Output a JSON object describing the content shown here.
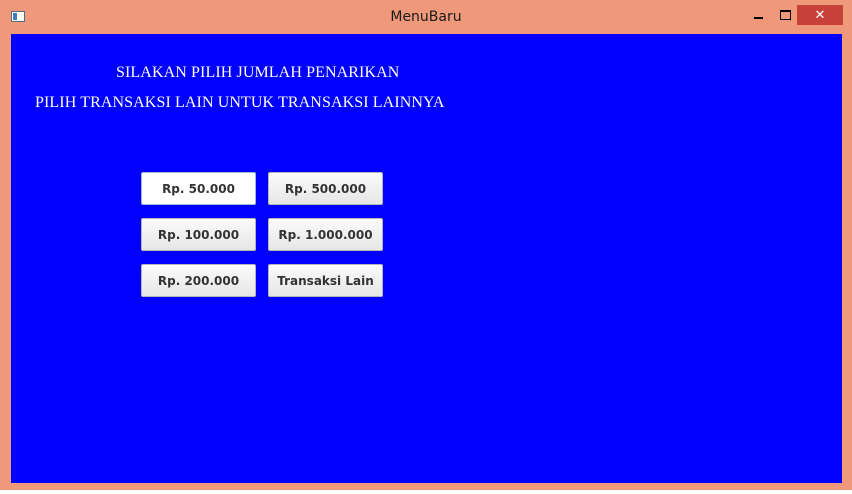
{
  "window": {
    "title": "MenuBaru",
    "controls": {
      "minimize": "minimize",
      "maximize": "maximize",
      "close": "✕"
    }
  },
  "main": {
    "heading_line1": "SILAKAN PILIH JUMLAH PENARIKAN",
    "heading_line2": "PILIH TRANSAKSI LAIN UNTUK TRANSAKSI LAINNYA",
    "buttons": [
      {
        "label": "Rp. 50.000"
      },
      {
        "label": "Rp. 500.000"
      },
      {
        "label": "Rp. 100.000"
      },
      {
        "label": "Rp. 1.000.000"
      },
      {
        "label": "Rp. 200.000"
      },
      {
        "label": "Transaksi Lain"
      }
    ]
  },
  "colors": {
    "panel_background": "#0000fc",
    "window_frame": "#f0997a",
    "close_button": "#c7403a"
  }
}
